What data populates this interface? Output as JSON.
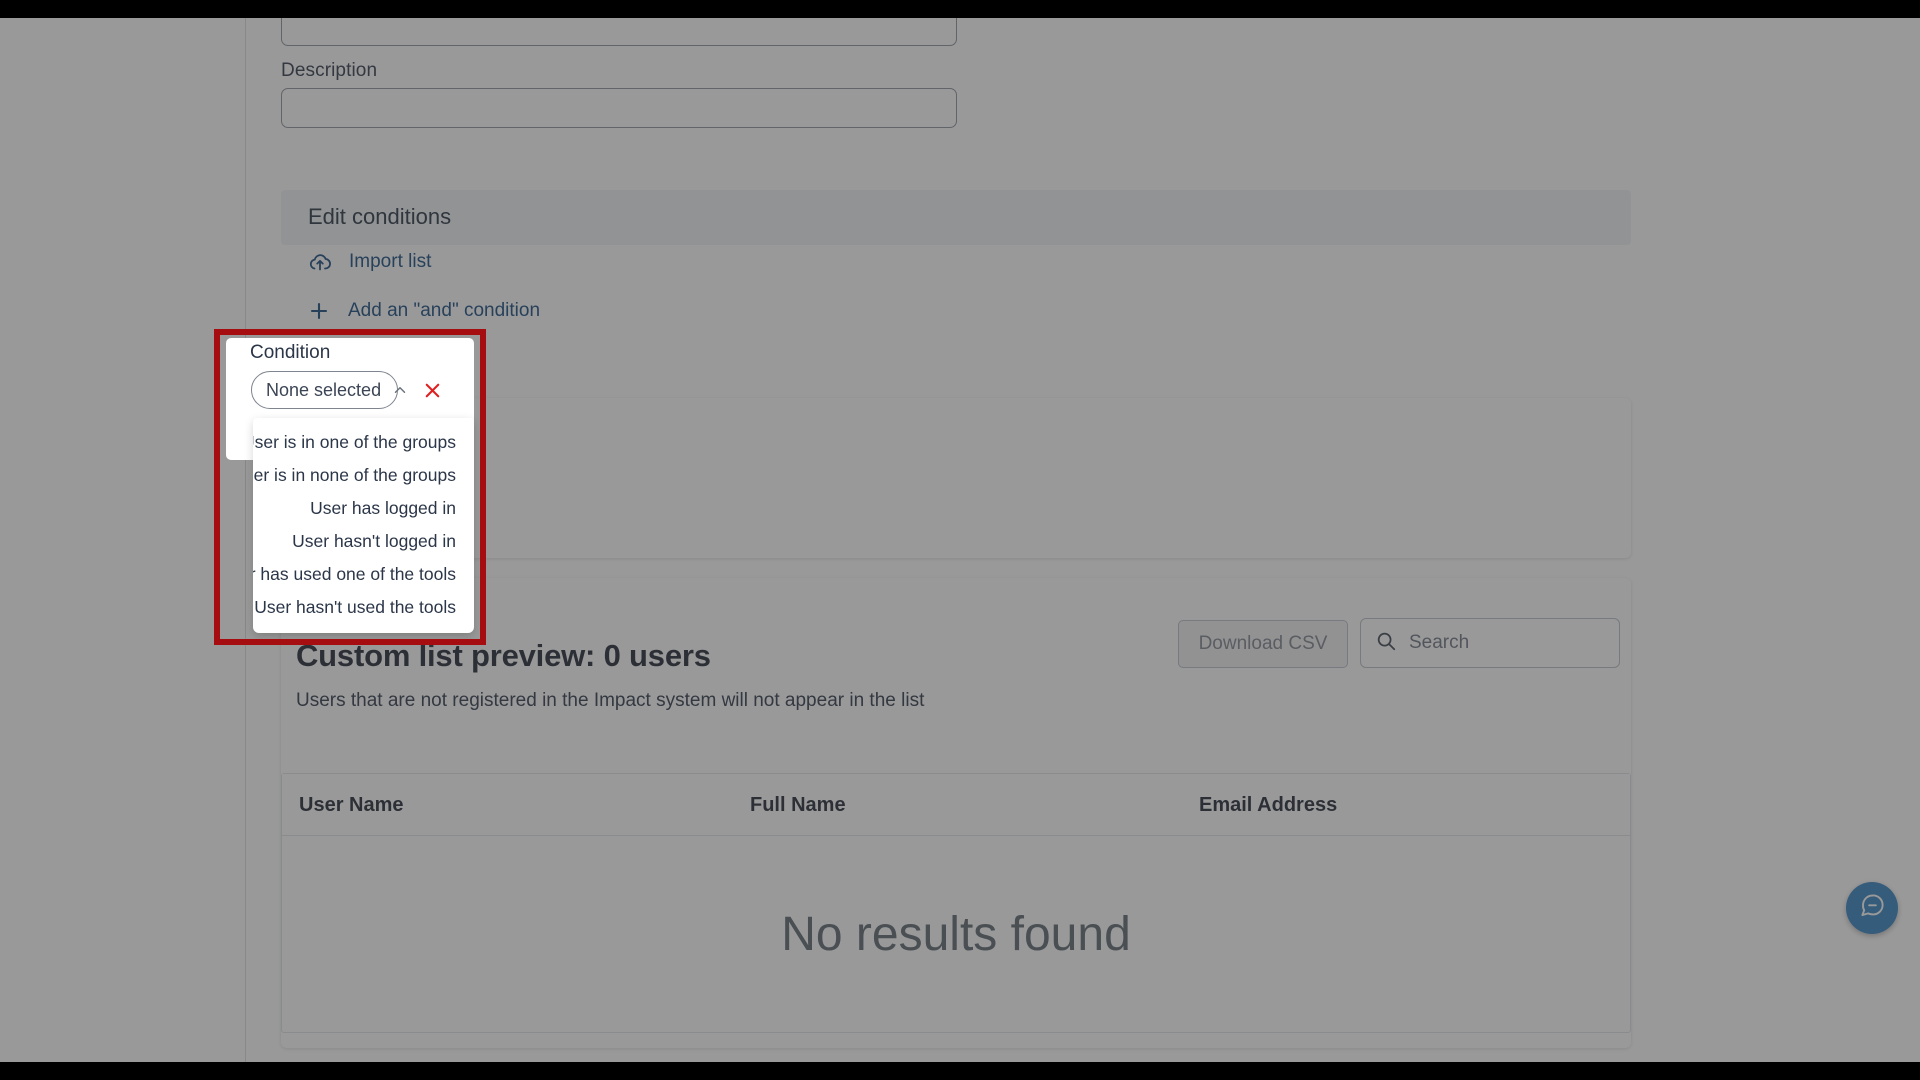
{
  "form": {
    "description_label": "Description",
    "description_value": "",
    "description_placeholder": ""
  },
  "conditions_section": {
    "title": "Edit conditions",
    "import_list_label": "Import list",
    "add_and_condition_label": "Add an \"and\" condition",
    "import_icon": "cloud-upload-icon",
    "add_icon": "plus-icon"
  },
  "condition_popup": {
    "label": "Condition",
    "selected_value": "None selected",
    "chevron_icon": "chevron-up-icon",
    "remove_icon": "close-x-icon",
    "remove_color": "#e02020",
    "highlight_color": "#a50d10",
    "options": [
      "User is in one of the groups",
      "User is in none of the groups",
      "User has logged in",
      "User hasn't logged in",
      "User has used one of the tools",
      "User hasn't used the tools"
    ]
  },
  "preview": {
    "title": "Custom list preview: 0 users",
    "description": "Users that are not registered in the Impact system will not appear in the list",
    "download_csv_label": "Download CSV",
    "search_placeholder": "Search",
    "search_value": "",
    "search_icon": "search-icon"
  },
  "table": {
    "columns": [
      "User Name",
      "Full Name",
      "Email Address"
    ],
    "rows": [],
    "empty_message": "No results found"
  },
  "fab": {
    "icon": "chat-bubble-icon",
    "color": "#2e7fc1"
  }
}
